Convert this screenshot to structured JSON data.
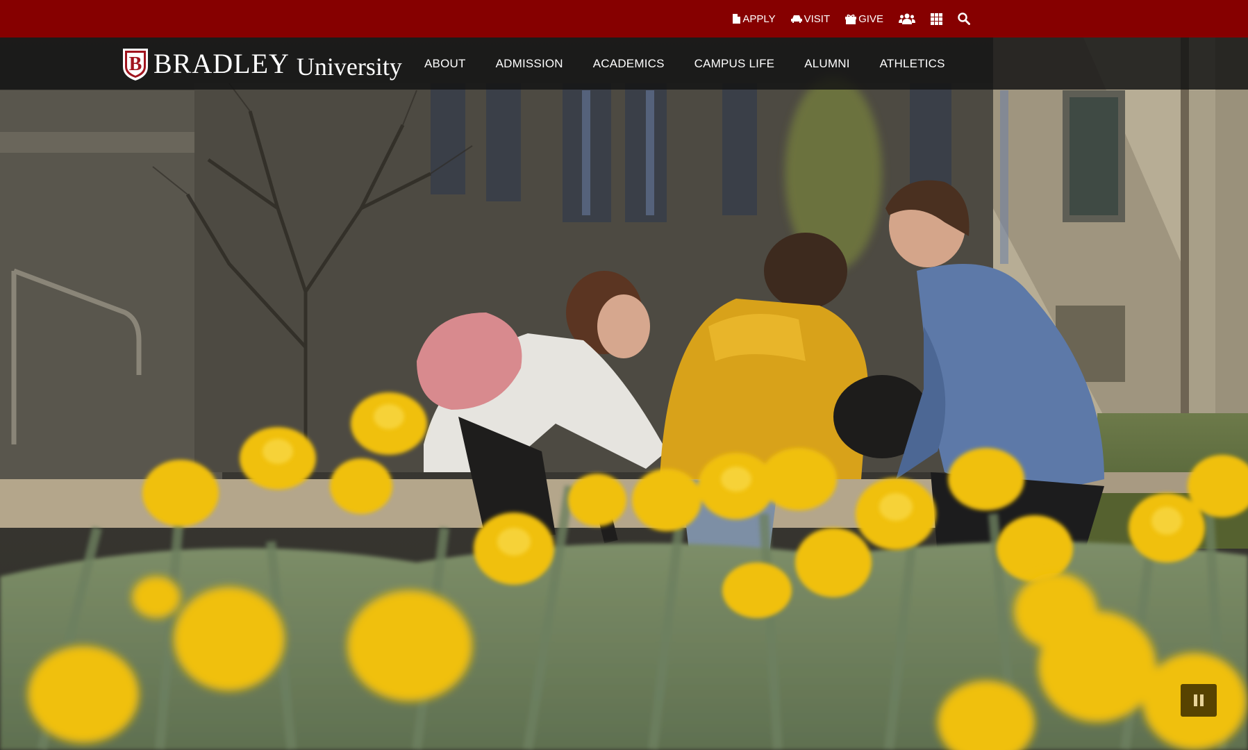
{
  "utility": {
    "apply_label": "APPLY",
    "visit_label": "VISIT",
    "give_label": "GIVE",
    "icons": [
      "file-icon",
      "car-icon",
      "gift-icon",
      "users-icon",
      "grid-icon",
      "search-icon"
    ]
  },
  "logo": {
    "name": "BRADLEY",
    "suffix": "University",
    "shield_letter": "B"
  },
  "nav": {
    "items": [
      {
        "label": "ABOUT"
      },
      {
        "label": "ADMISSION"
      },
      {
        "label": "ACADEMICS"
      },
      {
        "label": "CAMPUS LIFE"
      },
      {
        "label": "ALUMNI"
      },
      {
        "label": "ATHLETICS"
      }
    ]
  },
  "colors": {
    "utility_bar": "#860000",
    "nav_bar": "#141414",
    "accent_gold": "#f2c40e",
    "shield_red": "#a0141e"
  }
}
